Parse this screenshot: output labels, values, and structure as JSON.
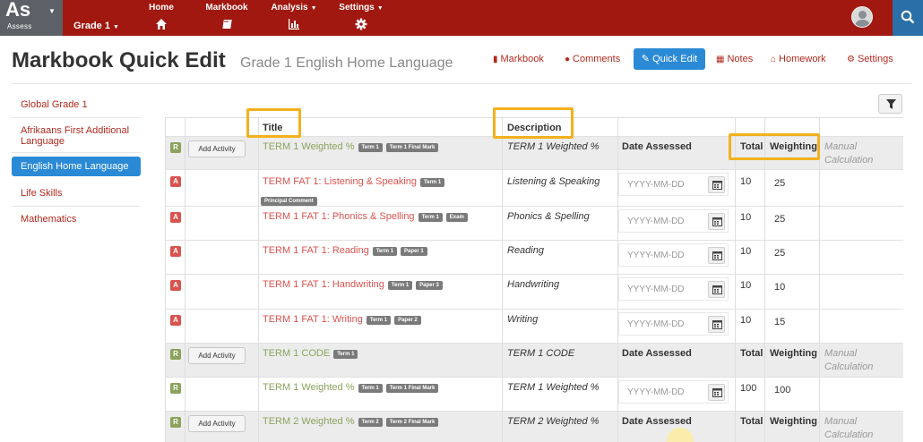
{
  "nav": {
    "logo": "As",
    "logo_sub": "Assess",
    "grade": "Grade 1",
    "items": [
      {
        "label": "Home",
        "icon": "home-icon"
      },
      {
        "label": "Markbook",
        "icon": "book-icon"
      },
      {
        "label": "Analysis",
        "icon": "bar-chart-icon"
      },
      {
        "label": "Settings",
        "icon": "gear-icon"
      }
    ]
  },
  "header": {
    "title": "Markbook Quick Edit",
    "subtitle": "Grade 1 English Home Language",
    "links": {
      "markbook": "Markbook",
      "comments": "Comments",
      "quick_edit": "Quick Edit",
      "notes": "Notes",
      "homework": "Homework",
      "settings": "Settings"
    }
  },
  "sidebar": {
    "items": [
      {
        "label": "Global Grade 1"
      },
      {
        "label": "Afrikaans First Additional Language"
      },
      {
        "label": "English Home Language"
      },
      {
        "label": "Life Skills"
      },
      {
        "label": "Mathematics"
      }
    ]
  },
  "table": {
    "headers": {
      "title": "Title",
      "description": "Description"
    },
    "add_activity": "Add Activity",
    "date_placeholder": "YYYY-MM-DD",
    "group_labels": {
      "date_assessed": "Date Assessed",
      "total": "Total",
      "weighting": "Weighting",
      "manual_1": "Manual",
      "manual_2": "Calculation"
    },
    "rows": [
      {
        "badge": "R",
        "title": "TERM 1 Weighted %",
        "tags": [
          "Term 1",
          "Term 1 Final Mark"
        ],
        "description": "TERM 1 Weighted %"
      },
      {
        "badge": "A",
        "title": "TERM FAT 1: Listening & Speaking",
        "tags": [
          "Term 1"
        ],
        "tags2": [
          "Principal Comment"
        ],
        "description": "Listening & Speaking",
        "total": "10",
        "weighting": "25"
      },
      {
        "badge": "A",
        "title": "TERM 1 FAT 1: Phonics & Spelling",
        "tags": [
          "Term 1",
          "Exam"
        ],
        "description": "Phonics & Spelling",
        "total": "10",
        "weighting": "25"
      },
      {
        "badge": "A",
        "title": "TERM 1 FAT 1: Reading",
        "tags": [
          "Term 1",
          "Paper 1"
        ],
        "description": "Reading",
        "total": "10",
        "weighting": "25"
      },
      {
        "badge": "A",
        "title": "TERM 1 FAT 1: Handwriting",
        "tags": [
          "Term 1",
          "Paper 3"
        ],
        "description": "Handwriting",
        "total": "10",
        "weighting": "10"
      },
      {
        "badge": "A",
        "title": "TERM 1 FAT 1: Writing",
        "tags": [
          "Term 1",
          "Paper 2"
        ],
        "description": "Writing",
        "total": "10",
        "weighting": "15"
      },
      {
        "badge": "R",
        "title": "TERM 1 CODE",
        "tags": [
          "Term 1"
        ],
        "description": "TERM 1 CODE"
      },
      {
        "badge": "R",
        "title": "TERM 1 Weighted %",
        "tags": [
          "Term 1",
          "Term 1 Final Mark"
        ],
        "description": "TERM 1 Weighted %",
        "total": "100",
        "weighting": "100"
      },
      {
        "badge": "R",
        "title": "TERM 2 Weighted %",
        "tags": [
          "Term 2",
          "Term 2 Final Mark"
        ],
        "description": "TERM 2 Weighted %"
      }
    ]
  }
}
